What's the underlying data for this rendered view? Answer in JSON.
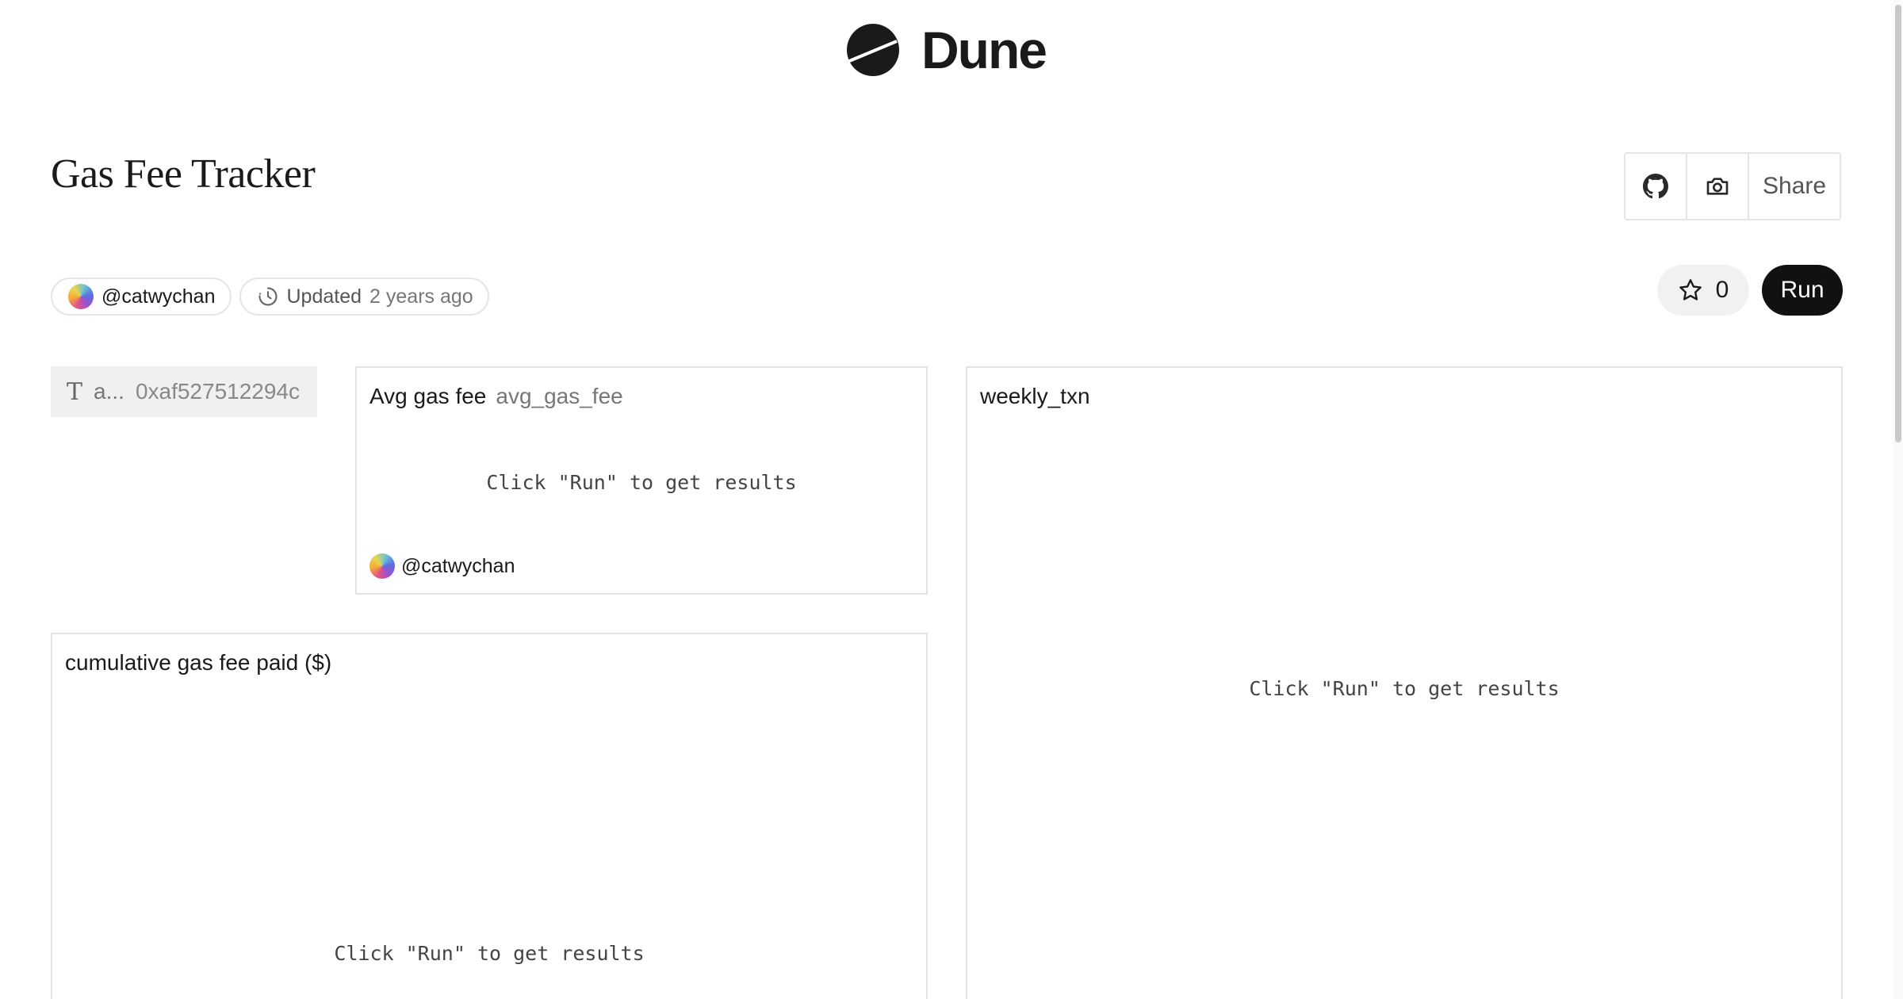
{
  "brand": {
    "name": "Dune",
    "icon": "dune-logo-icon"
  },
  "dashboard": {
    "title": "Gas Fee Tracker",
    "author": "@catwychan",
    "updated_label": "Updated",
    "updated_value": "2 years ago",
    "star_count": "0",
    "run_label": "Run"
  },
  "actions": {
    "github_icon": "github-icon",
    "screenshot_icon": "camera-icon",
    "share_label": "Share"
  },
  "parameter": {
    "icon_glyph": "T",
    "name": "a...",
    "value": "0xaf527512294c"
  },
  "panels": {
    "avg": {
      "title": "Avg gas fee",
      "subtitle": "avg_gas_fee",
      "placeholder": "Click \"Run\" to get results",
      "author": "@catwychan"
    },
    "weekly": {
      "title": "weekly_txn",
      "placeholder": "Click \"Run\" to get results"
    },
    "cumulative": {
      "title": "cumulative gas fee paid ($)",
      "placeholder": "Click \"Run\" to get results"
    }
  },
  "colors": {
    "run_button_bg": "#111111",
    "border": "#e3e3e3",
    "param_bg": "#f0f0f0",
    "star_bg": "#f1f1f1"
  }
}
